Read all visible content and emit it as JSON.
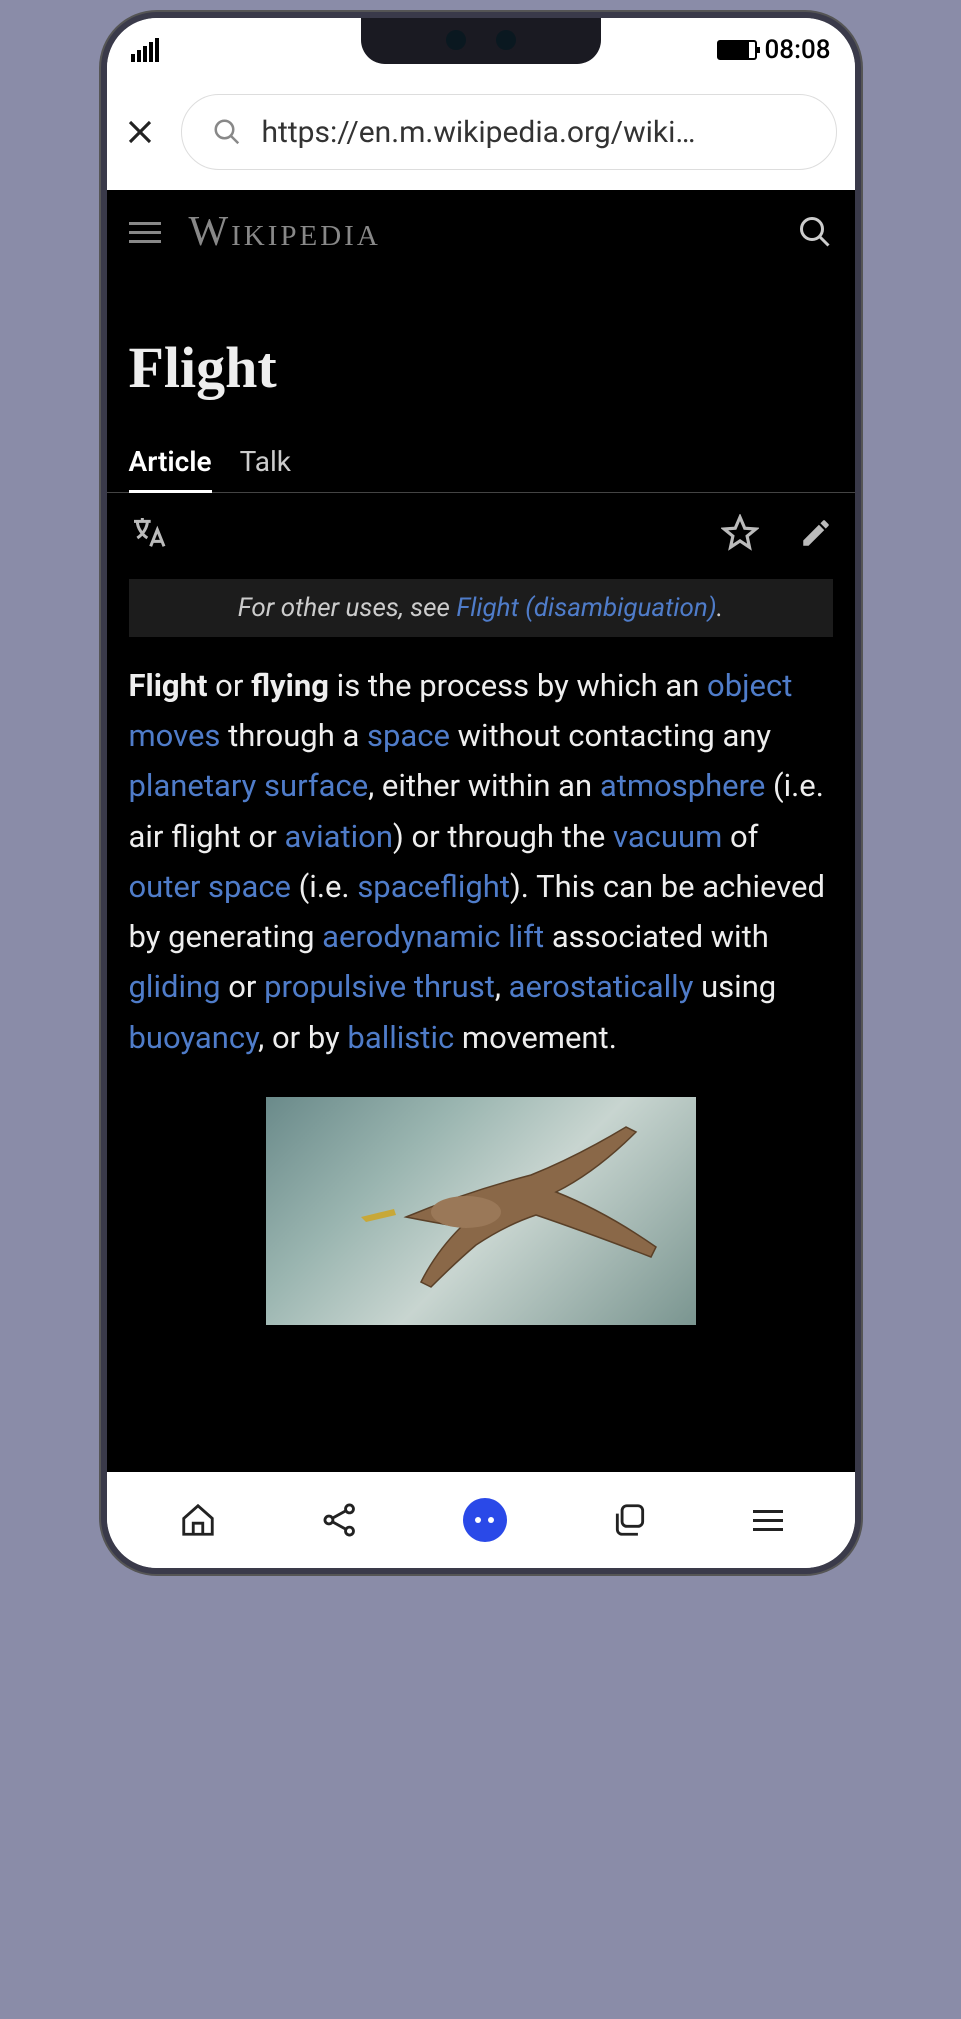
{
  "status": {
    "time": "08:08"
  },
  "browser": {
    "url": "https://en.m.wikipedia.org/wiki…"
  },
  "wiki": {
    "logo": "Wikipedia",
    "title": "Flight",
    "tabs": {
      "article": "Article",
      "talk": "Talk"
    },
    "disambig": {
      "prefix": "For other uses, see ",
      "link": "Flight (disambiguation)",
      "suffix": "."
    },
    "body": {
      "t1": "Flight",
      "t2": " or ",
      "t3": "flying",
      "t4": " is the process by which an ",
      "l1": "object",
      "t4b": " ",
      "l2": "moves",
      "t5": " through a ",
      "l3": "space",
      "t6": " without contacting any ",
      "l4": "planetary surface",
      "t7": ", either within an ",
      "l5": "atmosphere",
      "t8": " (i.e. air flight or ",
      "l6": "aviation",
      "t9": ") or through the ",
      "l7": "vacuum",
      "t10": " of ",
      "l8": "outer space",
      "t11": " (i.e. ",
      "l9": "spaceflight",
      "t12": "). This can be achieved by generating ",
      "l10": "aerodynamic lift",
      "t13": " associated with ",
      "l11": "gliding",
      "t14": " or ",
      "l12": "propulsive thrust",
      "t15": ", ",
      "l13": "aerostatically",
      "t16": " using ",
      "l14": "buoyancy",
      "t17": ", or by ",
      "l15": "ballistic",
      "t18": " movement."
    }
  }
}
